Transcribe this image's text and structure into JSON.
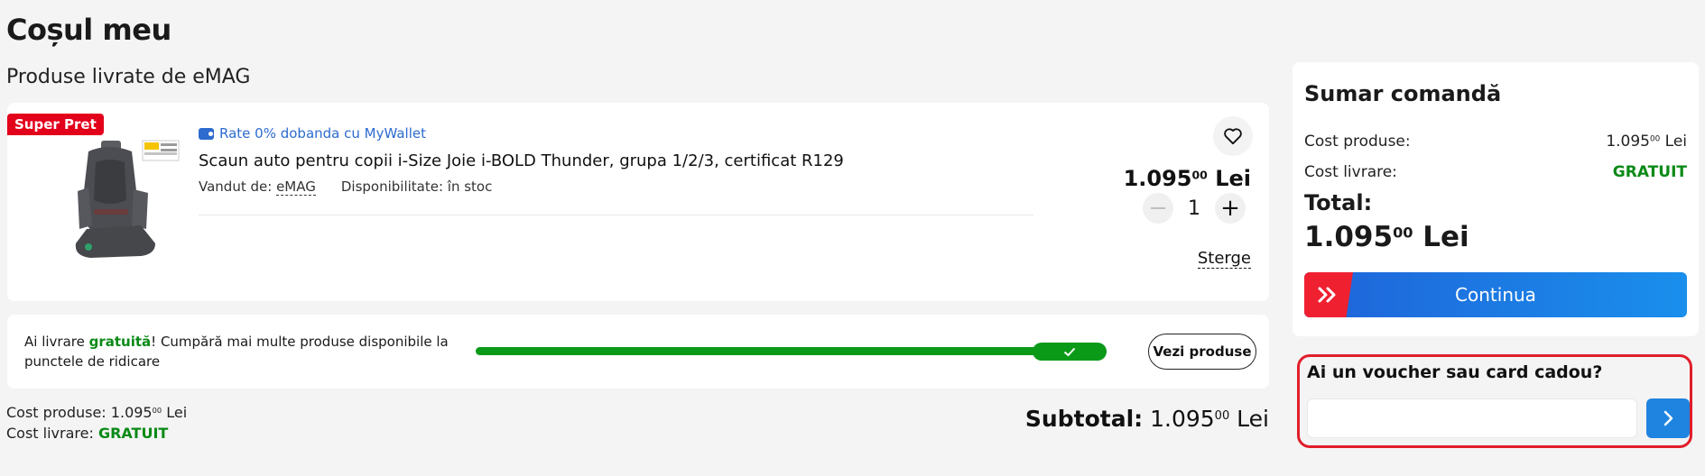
{
  "page": {
    "title": "Coșul meu",
    "section_title": "Produse livrate de eMAG"
  },
  "product": {
    "badge": "Super Pret",
    "wallet_promo": "Rate 0% dobanda cu MyWallet",
    "name": "Scaun auto pentru copii i-Size Joie i-BOLD Thunder, grupa 1/2/3, certificat R129",
    "seller_label": "Vandut de:",
    "seller": "eMAG",
    "availability": "Disponibilitate: în stoc",
    "price_int": "1.095",
    "price_dec": "00",
    "currency": "Lei",
    "quantity": "1",
    "remove_label": "Sterge",
    "icons": {
      "favorite": "heart-icon",
      "wallet": "wallet-icon",
      "minus": "minus-icon",
      "plus": "plus-icon"
    }
  },
  "shipping": {
    "text_before": "Ai livrare ",
    "text_free": "gratuită",
    "text_after": "! Cumpără mai multe produse disponibile la punctele de ridicare",
    "progress": 1.0,
    "button": "Vezi produse"
  },
  "footer": {
    "products_label": "Cost produse:",
    "products_int": "1.095",
    "products_dec": "00",
    "products_currency": "Lei",
    "delivery_label": "Cost livrare:",
    "delivery_value": "GRATUIT",
    "subtotal_label": "Subtotal:",
    "subtotal_int": "1.095",
    "subtotal_dec": "00",
    "subtotal_currency": "Lei"
  },
  "summary": {
    "title": "Sumar comandă",
    "products_label": "Cost produse:",
    "products_int": "1.095",
    "products_dec": "00",
    "products_currency": "Lei",
    "delivery_label": "Cost livrare:",
    "delivery_value": "GRATUIT",
    "total_label": "Total:",
    "total_int": "1.095",
    "total_dec": "00",
    "total_currency": "Lei",
    "continue": "Continua"
  },
  "voucher": {
    "title": "Ai un voucher sau card cadou?",
    "input_value": "",
    "placeholder": ""
  },
  "colors": {
    "accent_blue": "#1f84e0",
    "brand_red": "#e3001b",
    "success_green": "#0a9a18",
    "highlight_border": "#e01e2a"
  }
}
